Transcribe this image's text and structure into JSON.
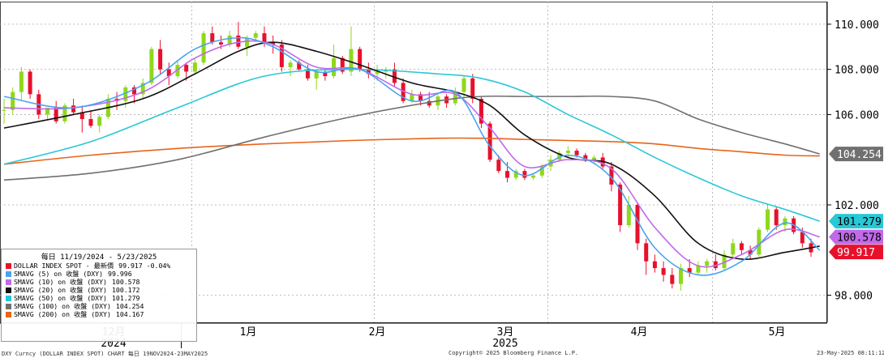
{
  "chart_data": {
    "type": "candlestick",
    "period": "11/19/2024 - 5/23/2025",
    "ylim": [
      96.8,
      111.0
    ],
    "y_ticks": [
      "98.000",
      "102.000",
      "106.000",
      "108.000",
      "110.000"
    ],
    "x_months": [
      "12月",
      "1月",
      "2月",
      "3月",
      "4月",
      "5月"
    ],
    "x_years": [
      "2024",
      "2025"
    ],
    "candles": [
      [
        106.2,
        106.7,
        105.6,
        106.2
      ],
      [
        106.2,
        107.2,
        106.0,
        107.0
      ],
      [
        107.0,
        108.1,
        106.6,
        107.9
      ],
      [
        107.9,
        108.0,
        106.7,
        106.9
      ],
      [
        106.9,
        107.1,
        105.8,
        106.0
      ],
      [
        106.0,
        106.3,
        105.8,
        106.3
      ],
      [
        106.3,
        106.6,
        105.6,
        105.7
      ],
      [
        105.7,
        106.5,
        105.6,
        106.4
      ],
      [
        106.4,
        106.7,
        106.0,
        106.1
      ],
      [
        106.1,
        106.4,
        105.2,
        105.8
      ],
      [
        105.8,
        106.2,
        105.4,
        105.5
      ],
      [
        105.5,
        106.0,
        105.2,
        105.9
      ],
      [
        105.9,
        106.9,
        105.8,
        106.7
      ],
      [
        106.7,
        107.0,
        106.2,
        106.6
      ],
      [
        106.6,
        107.3,
        106.3,
        107.2
      ],
      [
        107.2,
        107.3,
        106.5,
        106.9
      ],
      [
        106.9,
        107.6,
        106.7,
        107.4
      ],
      [
        107.4,
        109.0,
        107.3,
        108.9
      ],
      [
        108.9,
        109.3,
        107.8,
        108.0
      ],
      [
        108.0,
        108.3,
        107.3,
        107.7
      ],
      [
        107.7,
        108.4,
        107.6,
        108.2
      ],
      [
        108.2,
        108.3,
        107.5,
        107.9
      ],
      [
        107.9,
        108.5,
        107.8,
        108.3
      ],
      [
        108.3,
        109.7,
        108.2,
        109.6
      ],
      [
        109.6,
        109.9,
        109.1,
        109.2
      ],
      [
        109.2,
        109.5,
        108.9,
        109.1
      ],
      [
        109.1,
        109.7,
        109.0,
        109.5
      ],
      [
        109.5,
        110.1,
        108.9,
        109.0
      ],
      [
        109.0,
        109.5,
        108.6,
        109.4
      ],
      [
        109.4,
        109.7,
        109.2,
        109.6
      ],
      [
        109.6,
        109.9,
        109.0,
        109.2
      ],
      [
        109.2,
        109.5,
        108.7,
        109.1
      ],
      [
        109.1,
        109.3,
        107.9,
        108.1
      ],
      [
        108.1,
        108.4,
        107.7,
        108.3
      ],
      [
        108.3,
        108.4,
        107.9,
        108.0
      ],
      [
        108.0,
        108.2,
        107.5,
        107.6
      ],
      [
        107.6,
        108.0,
        107.1,
        107.9
      ],
      [
        107.9,
        108.0,
        107.5,
        107.7
      ],
      [
        107.7,
        109.1,
        107.6,
        108.5
      ],
      [
        108.5,
        108.6,
        107.8,
        107.9
      ],
      [
        107.9,
        109.9,
        107.7,
        108.9
      ],
      [
        108.9,
        109.0,
        107.9,
        108.0
      ],
      [
        108.0,
        108.3,
        107.6,
        107.8
      ],
      [
        107.8,
        108.2,
        107.5,
        107.9
      ],
      [
        107.9,
        108.1,
        107.6,
        108.0
      ],
      [
        108.0,
        108.3,
        107.2,
        107.4
      ],
      [
        107.4,
        107.6,
        106.5,
        106.6
      ],
      [
        106.6,
        107.1,
        106.5,
        106.9
      ],
      [
        106.9,
        107.0,
        106.4,
        106.6
      ],
      [
        106.6,
        107.0,
        106.3,
        106.4
      ],
      [
        106.4,
        106.9,
        106.2,
        106.8
      ],
      [
        106.8,
        106.9,
        106.3,
        106.5
      ],
      [
        106.5,
        107.2,
        106.4,
        107.0
      ],
      [
        107.0,
        107.7,
        106.7,
        107.6
      ],
      [
        107.6,
        107.8,
        106.5,
        106.7
      ],
      [
        106.7,
        106.8,
        105.4,
        105.6
      ],
      [
        105.6,
        105.7,
        103.9,
        104.0
      ],
      [
        104.0,
        104.2,
        103.4,
        103.5
      ],
      [
        103.5,
        103.9,
        103.0,
        103.2
      ],
      [
        103.2,
        103.6,
        103.1,
        103.5
      ],
      [
        103.5,
        103.6,
        103.1,
        103.2
      ],
      [
        103.2,
        103.4,
        103.1,
        103.3
      ],
      [
        103.3,
        103.8,
        103.2,
        103.7
      ],
      [
        103.7,
        104.2,
        103.5,
        104.0
      ],
      [
        104.0,
        104.4,
        103.9,
        104.3
      ],
      [
        104.3,
        104.6,
        104.1,
        104.4
      ],
      [
        104.4,
        104.5,
        104.1,
        104.2
      ],
      [
        104.2,
        104.3,
        103.9,
        104.0
      ],
      [
        104.0,
        104.2,
        103.8,
        104.1
      ],
      [
        104.1,
        104.3,
        103.6,
        103.7
      ],
      [
        103.7,
        103.9,
        102.6,
        102.9
      ],
      [
        102.9,
        103.0,
        100.8,
        101.1
      ],
      [
        101.1,
        102.4,
        101.0,
        102.0
      ],
      [
        102.0,
        102.1,
        100.0,
        100.3
      ],
      [
        100.3,
        100.5,
        98.9,
        99.5
      ],
      [
        99.5,
        99.8,
        99.0,
        99.2
      ],
      [
        99.2,
        99.5,
        98.6,
        98.9
      ],
      [
        98.9,
        99.2,
        98.3,
        98.5
      ],
      [
        98.5,
        99.4,
        98.2,
        99.2
      ],
      [
        99.2,
        99.6,
        98.8,
        99.0
      ],
      [
        99.0,
        99.5,
        98.9,
        99.3
      ],
      [
        99.3,
        99.6,
        99.0,
        99.5
      ],
      [
        99.5,
        99.8,
        99.1,
        99.2
      ],
      [
        99.2,
        100.0,
        99.1,
        99.8
      ],
      [
        99.8,
        100.5,
        99.6,
        100.3
      ],
      [
        100.3,
        100.4,
        99.8,
        100.0
      ],
      [
        100.0,
        100.2,
        99.6,
        99.8
      ],
      [
        99.8,
        101.0,
        99.7,
        100.9
      ],
      [
        100.9,
        102.0,
        100.8,
        101.8
      ],
      [
        101.8,
        101.9,
        100.9,
        101.1
      ],
      [
        101.1,
        101.5,
        100.8,
        101.4
      ],
      [
        101.4,
        101.5,
        100.7,
        100.8
      ],
      [
        100.8,
        101.0,
        100.1,
        100.3
      ],
      [
        100.3,
        100.5,
        99.7,
        99.9
      ]
    ],
    "series": [
      {
        "name": "DOLLAR INDEX SPOT - 最新價",
        "last": "99.917",
        "change": "-0.04%",
        "color": "#e8102a",
        "label": "99.917"
      },
      {
        "name": "SMAVG (5)  on 收盤 (DXY)",
        "last": "99.996",
        "color": "#4aa3f0",
        "x": [
          0,
          8,
          16,
          22,
          27,
          31,
          36,
          41,
          47,
          52,
          56,
          60,
          65,
          70,
          75,
          80,
          85,
          90,
          94
        ],
        "values": [
          106.8,
          106.3,
          107.3,
          108.9,
          109.4,
          109.0,
          107.9,
          108.0,
          106.6,
          107.0,
          104.6,
          103.3,
          104.2,
          103.2,
          100.1,
          98.9,
          99.5,
          101.2,
          99.996
        ]
      },
      {
        "name": "SMAVG (10)  on 收盤 (DXY)",
        "last": "100.578",
        "color": "#c06ae8",
        "label": "100.578",
        "x": [
          0,
          8,
          16,
          22,
          27,
          31,
          36,
          41,
          47,
          52,
          56,
          60,
          65,
          70,
          75,
          80,
          85,
          90,
          94
        ],
        "values": [
          106.3,
          106.3,
          107.0,
          108.5,
          109.2,
          109.1,
          108.1,
          108.0,
          106.9,
          106.9,
          105.4,
          103.7,
          104.0,
          103.6,
          101.0,
          99.3,
          99.8,
          100.9,
          100.578
        ]
      },
      {
        "name": "SMAVG (20)  on 收盤 (DXY)",
        "last": "100.172",
        "color": "#111111",
        "x": [
          0,
          8,
          16,
          22,
          27,
          31,
          36,
          41,
          47,
          52,
          56,
          60,
          65,
          70,
          75,
          80,
          85,
          90,
          94
        ],
        "values": [
          105.4,
          106.0,
          106.7,
          107.8,
          108.8,
          109.2,
          108.8,
          108.2,
          107.4,
          107.0,
          106.4,
          105.1,
          104.1,
          103.8,
          102.4,
          100.3,
          99.6,
          99.9,
          100.172
        ]
      },
      {
        "name": "SMAVG (50)  on 收盤 (DXY)",
        "last": "101.279",
        "color": "#28c8d6",
        "label": "101.279",
        "x": [
          0,
          10,
          20,
          30,
          40,
          50,
          55,
          60,
          65,
          70,
          75,
          80,
          85,
          90,
          94
        ],
        "values": [
          103.8,
          104.8,
          106.3,
          107.7,
          108.0,
          107.8,
          107.6,
          107.0,
          106.0,
          105.1,
          104.1,
          103.2,
          102.4,
          101.8,
          101.279
        ]
      },
      {
        "name": "SMAVG (100)  on 收盤 (DXY)",
        "last": "104.254",
        "color": "#707070",
        "label": "104.254",
        "x": [
          0,
          10,
          20,
          30,
          40,
          50,
          55,
          60,
          65,
          70,
          75,
          80,
          85,
          90,
          94
        ],
        "values": [
          103.1,
          103.4,
          104.0,
          105.0,
          105.9,
          106.6,
          106.8,
          106.8,
          106.8,
          106.8,
          106.6,
          105.8,
          105.2,
          104.7,
          104.254
        ]
      },
      {
        "name": "SMAVG (200)  on 收盤 (DXY)",
        "last": "104.167",
        "color": "#e8641a",
        "x": [
          0,
          10,
          20,
          30,
          40,
          50,
          55,
          60,
          65,
          70,
          75,
          80,
          85,
          90,
          94
        ],
        "values": [
          103.8,
          104.2,
          104.5,
          104.7,
          104.85,
          104.95,
          104.95,
          104.9,
          104.85,
          104.8,
          104.7,
          104.5,
          104.35,
          104.2,
          104.167
        ]
      }
    ],
    "legend_title": "每日 11/19/2024 - 5/23/2025",
    "legend_position": "bottom-left"
  },
  "footer": {
    "left": "DXY Curncy (DOLLAR INDEX SPOT) CHART  每日 19NOV2024-23MAY2025",
    "center": "Copyright© 2025 Bloomberg Finance L.P.",
    "right": "23-May-2025 08:11:12"
  }
}
